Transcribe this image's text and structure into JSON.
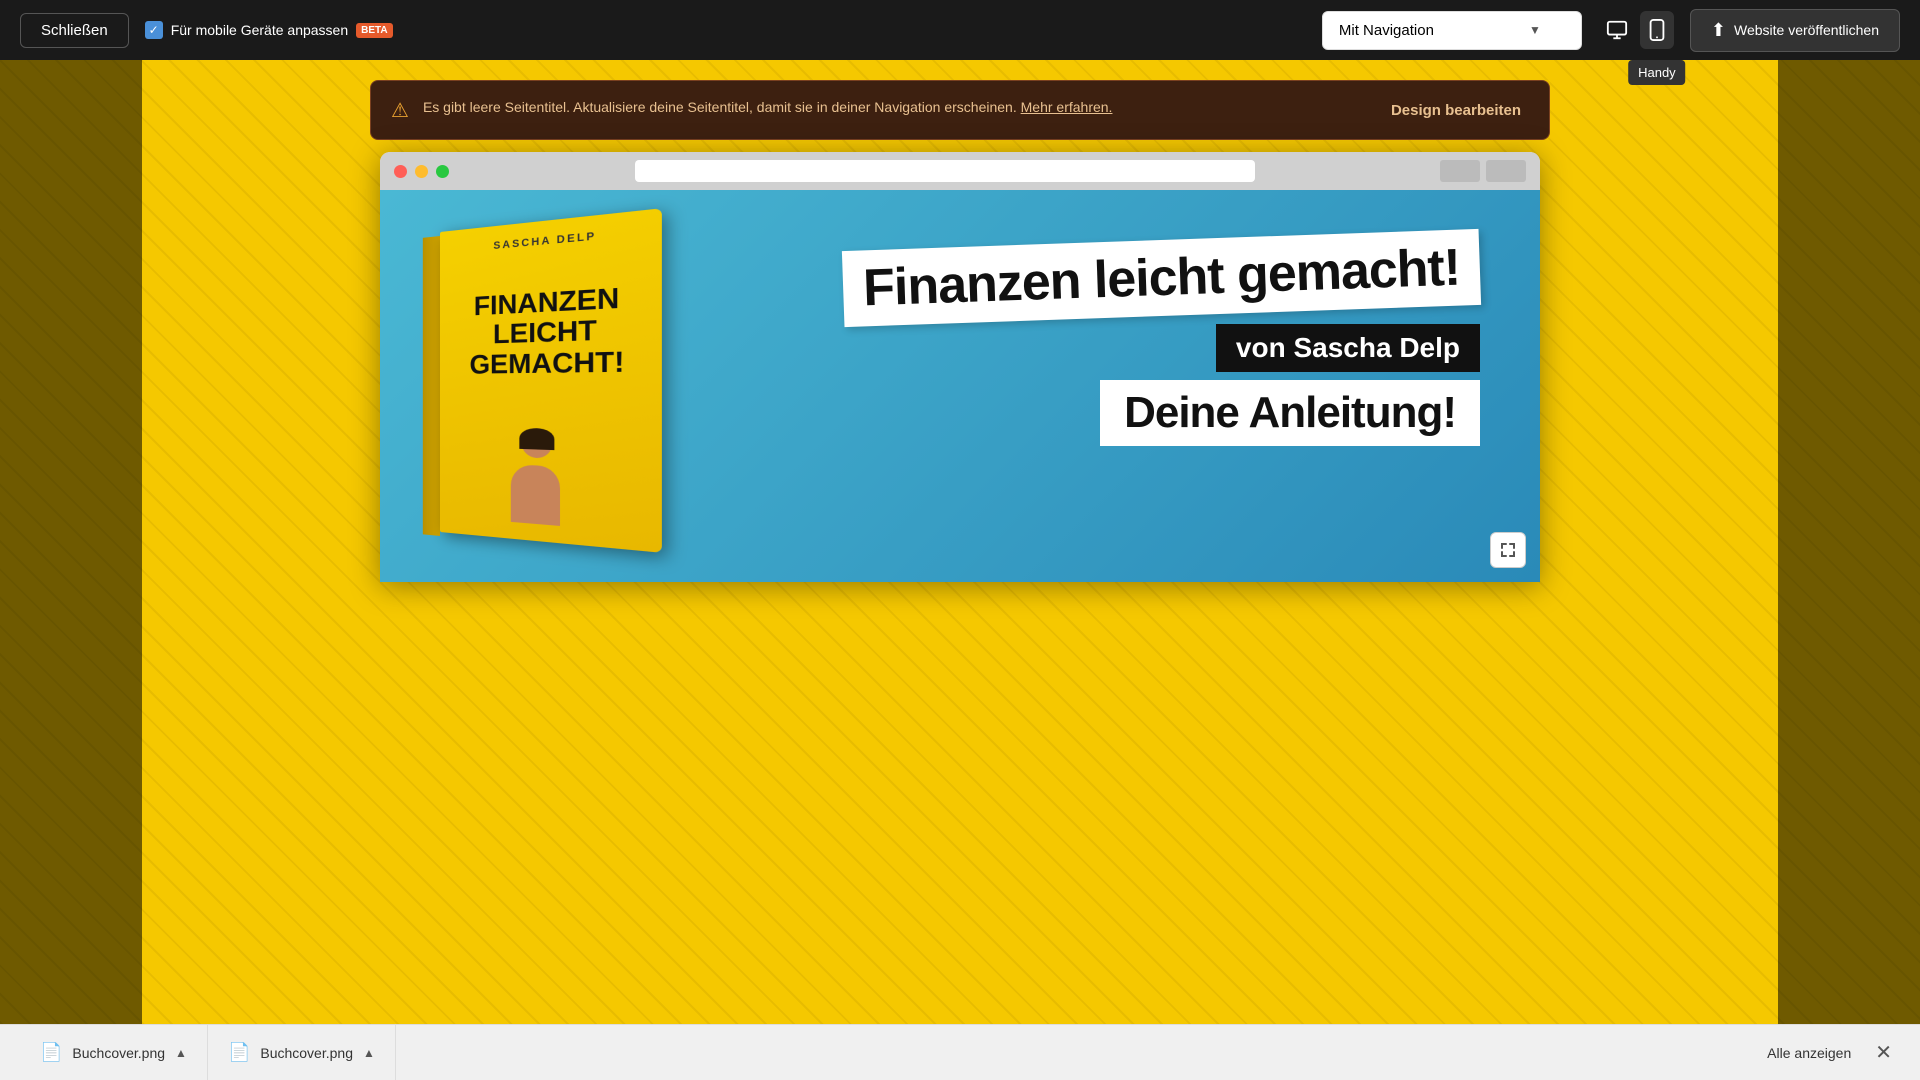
{
  "toolbar": {
    "close_label": "Schließen",
    "mobile_toggle_label": "Für mobile Geräte anpassen",
    "beta_label": "BETA",
    "nav_dropdown_label": "Mit Navigation",
    "tooltip_handy": "Handy",
    "publish_label": "Website veröffentlichen"
  },
  "warning": {
    "text": "Es gibt leere Seitentitel. Aktualisiere deine Seitentitel, damit sie in deiner Navigation erscheinen.",
    "link_label": "Mehr erfahren.",
    "action_label": "Design bearbeiten"
  },
  "preview": {
    "headline_main": "Finanzen leicht gemacht!",
    "headline_author": "von Sascha Delp",
    "headline_sub": "Deine Anleitung!",
    "book_author": "SASCHA DELP",
    "book_title_line1": "FINANZEN",
    "book_title_line2": "LEICHT",
    "book_title_line3": "GEMACHT!"
  },
  "downloads": {
    "item1_name": "Buchcover.png",
    "item2_name": "Buchcover.png",
    "alle_label": "Alle anzeigen"
  }
}
